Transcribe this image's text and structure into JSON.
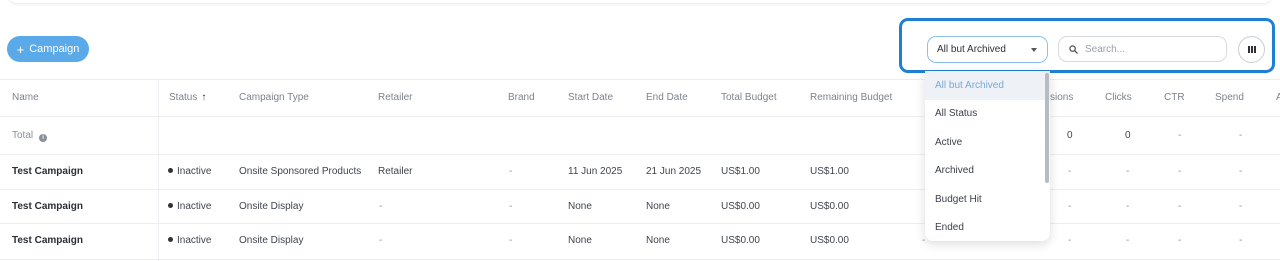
{
  "toolbar": {
    "add_campaign_label": "Campaign",
    "add_icon": "plus-icon",
    "status_filter_value": "All but Archived",
    "search_placeholder": "Search...",
    "columns_icon": "columns-icon",
    "highlight_color": "#1e7fd6",
    "accent_color": "#5aa9e8"
  },
  "table": {
    "headers": {
      "name": "Name",
      "status": "Status",
      "status_sort_icon": "sort-ascending-icon",
      "campaign_type": "Campaign Type",
      "retailer": "Retailer",
      "brand": "Brand",
      "start_date": "Start Date",
      "end_date": "End Date",
      "total_budget": "Total Budget",
      "remaining_budget": "Remaining Budget",
      "impressions": "sions",
      "clicks": "Clicks",
      "ctr": "CTR",
      "spend": "Spend",
      "last": "A"
    },
    "total": {
      "label": "Total",
      "info_icon": "info-icon",
      "impressions": "0",
      "clicks": "0",
      "ctr": "-",
      "spend": "-"
    },
    "rows": [
      {
        "name": "Test Campaign",
        "status": "Inactive",
        "campaign_type": "Onsite Sponsored Products",
        "retailer": "Retailer",
        "brand": "-",
        "start_date": "11 Jun 2025",
        "end_date": "21 Jun 2025",
        "total_budget": "US$1.00",
        "remaining_budget": "US$1.00",
        "impressions": "-",
        "clicks": "-",
        "ctr": "-",
        "spend": "-"
      },
      {
        "name": "Test Campaign",
        "status": "Inactive",
        "campaign_type": "Onsite Display",
        "retailer": "-",
        "brand": "-",
        "start_date": "None",
        "end_date": "None",
        "total_budget": "US$0.00",
        "remaining_budget": "US$0.00",
        "impressions": "-",
        "clicks": "-",
        "ctr": "-",
        "spend": "-"
      },
      {
        "name": "Test Campaign",
        "status": "Inactive",
        "campaign_type": "Onsite Display",
        "retailer": "-",
        "brand": "-",
        "start_date": "None",
        "end_date": "None",
        "total_budget": "US$0.00",
        "remaining_budget": "US$0.00",
        "hidden_dash": "-",
        "impressions": "-",
        "clicks": "-",
        "ctr": "-",
        "spend": "-"
      }
    ]
  },
  "status_dropdown": {
    "options": [
      "All but Archived",
      "All Status",
      "Active",
      "Archived",
      "Budget Hit",
      "Ended"
    ],
    "selected": "All but Archived"
  }
}
